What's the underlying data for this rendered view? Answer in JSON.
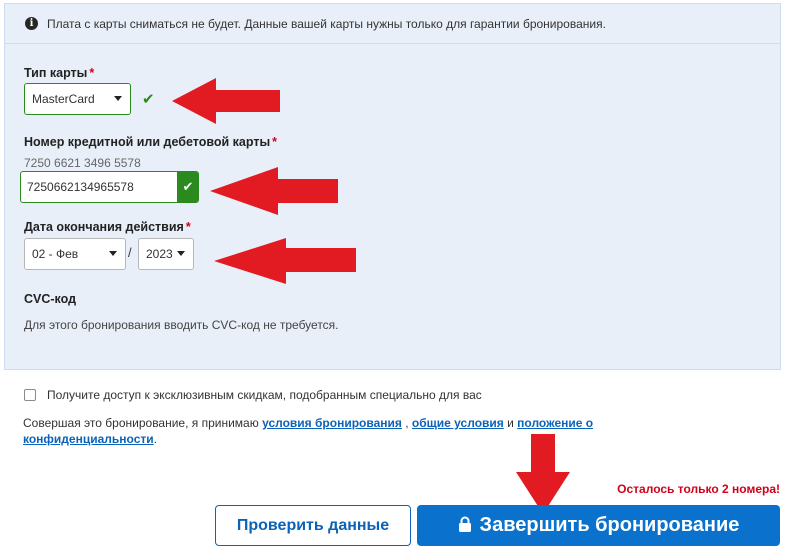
{
  "notice": {
    "icon": "info-icon",
    "text": "Плата с карты сниматься не будет. Данные вашей карты нужны только для гарантии бронирования."
  },
  "card_type": {
    "label": "Тип карты",
    "required_mark": "*",
    "value": "MasterCard",
    "valid_icon": "checkmark-icon"
  },
  "card_number": {
    "label": "Номер кредитной или дебетовой карты",
    "required_mark": "*",
    "hint": "7250 6621 3496 5578",
    "value": "7250662134965578",
    "valid_icon": "checkmark-icon"
  },
  "expiry": {
    "label": "Дата окончания действия",
    "required_mark": "*",
    "month": "02 - Фев",
    "separator": "/",
    "year": "2023"
  },
  "cvc": {
    "label": "CVC-код",
    "text": "Для этого бронирования вводить CVC-код не требуется."
  },
  "newsletter": {
    "checked": false,
    "label": "Получите доступ к эксклюзивным скидкам, подобранным специально для вас"
  },
  "terms": {
    "prefix": "Совершая это бронирование, я принимаю",
    "link1": "условия бронирования",
    "sep1": ",",
    "link2": "общие условия",
    "and": "и",
    "link3": "положение о конфиденциальности",
    "suffix": "."
  },
  "rooms_left": "Осталось только 2 номера!",
  "buttons": {
    "check_label": "Проверить данные",
    "book_label": "Завершить бронирование",
    "book_icon": "lock-icon"
  },
  "colors": {
    "accent": "#0a72cc",
    "link": "#0a63b8",
    "valid": "#2b8a1e",
    "warning": "#d0021b",
    "annotation_arrow": "#e21b23",
    "panel_bg": "#e9eff9"
  }
}
